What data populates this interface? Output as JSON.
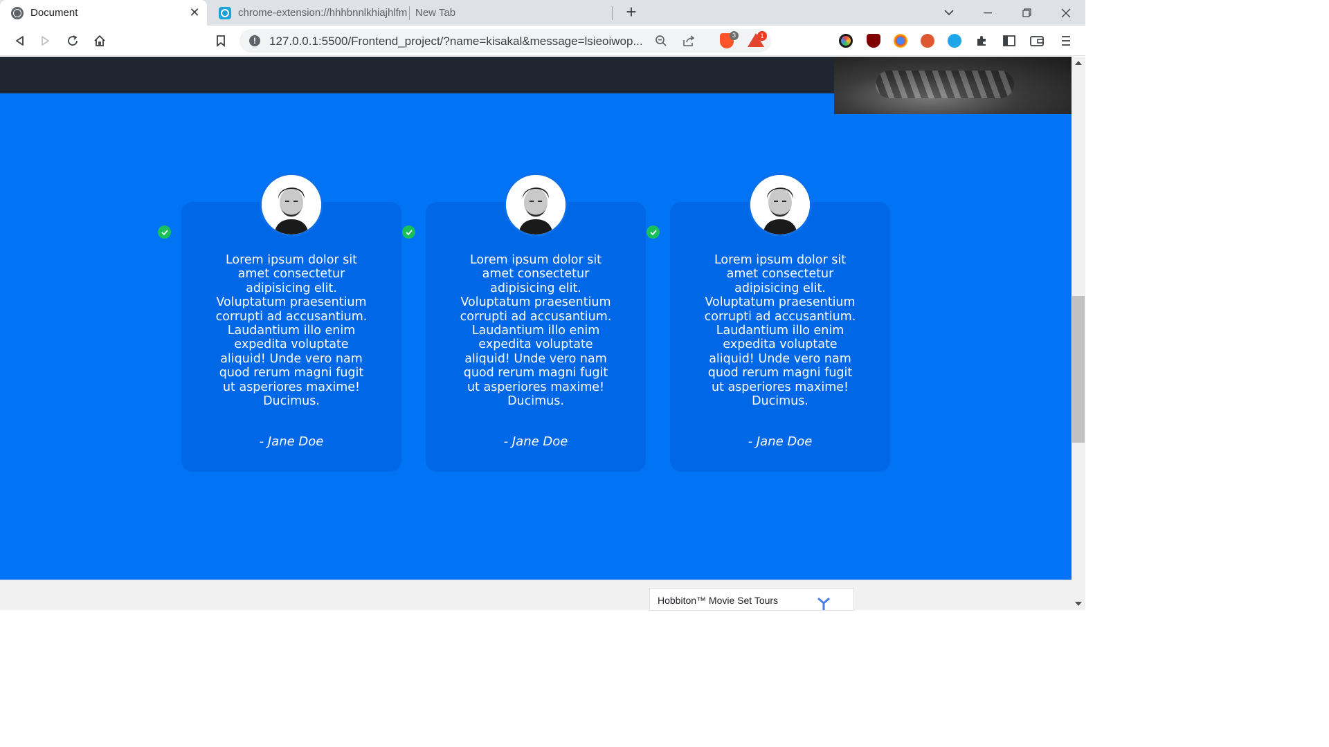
{
  "browser": {
    "tabs": [
      {
        "title": "Document",
        "active": true,
        "favicon": "globe-icon"
      },
      {
        "title": "chrome-extension://hhhbnnlkhiajhlfm",
        "active": false,
        "favicon": "extension-favicon-icon"
      },
      {
        "title": "New Tab",
        "active": false
      }
    ],
    "url": "127.0.0.1:5500/Frontend_project/?name=kisakal&message=lsieoiwop...",
    "brave_shield_count": "3",
    "brave_rewards_count": "1"
  },
  "page": {
    "colors": {
      "section_bg": "#0074f4",
      "card_bg": "#0068e6",
      "dark_band": "#1f2531",
      "check": "#19c15a"
    },
    "testimonials": [
      {
        "text": "Lorem ipsum dolor sit amet consectetur adipisicing elit. Voluptatum praesentium corrupti ad accusantium. Laudantium illo enim expedita voluptate aliquid! Unde vero nam quod rerum magni fugit ut asperiores maxime! Ducimus.",
        "author": "- Jane Doe"
      },
      {
        "text": "Lorem ipsum dolor sit amet consectetur adipisicing elit. Voluptatum praesentium corrupti ad accusantium. Laudantium illo enim expedita voluptate aliquid! Unde vero nam quod rerum magni fugit ut asperiores maxime! Ducimus.",
        "author": "- Jane Doe"
      },
      {
        "text": "Lorem ipsum dolor sit amet consectetur adipisicing elit. Voluptatum praesentium corrupti ad accusantium. Laudantium illo enim expedita voluptate aliquid! Unde vero nam quod rerum magni fugit ut asperiores maxime! Ducimus.",
        "author": "- Jane Doe"
      }
    ]
  },
  "ad": {
    "text": "Hobbiton™ Movie Set Tours"
  }
}
